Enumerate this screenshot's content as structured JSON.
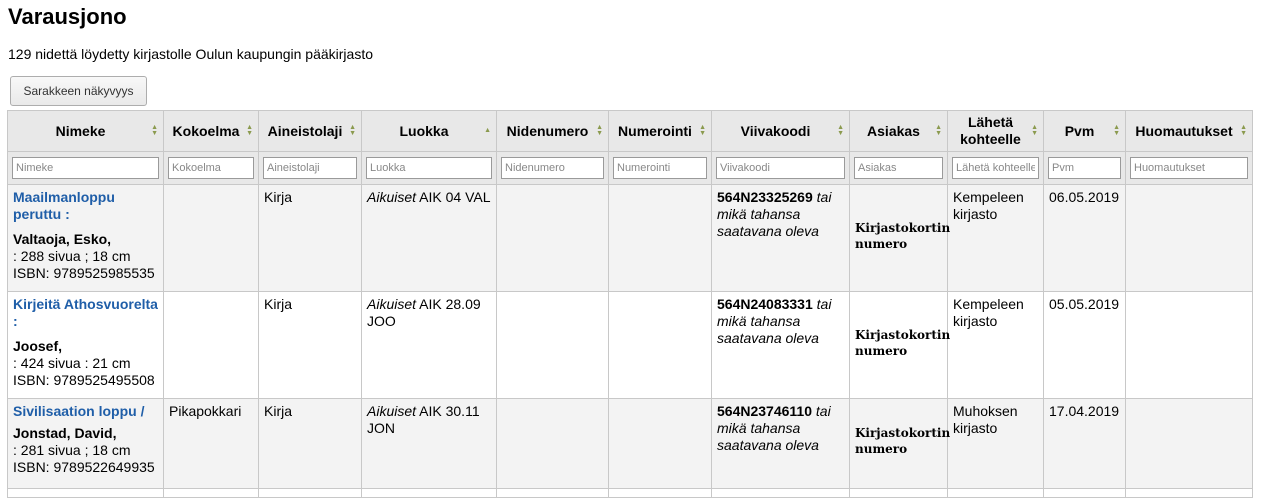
{
  "page": {
    "title": "Varausjono",
    "summary": "129 nidettä löydetty kirjastolle Oulun kaupungin pääkirjasto",
    "column_visibility_label": "Sarakkeen näkyvyys"
  },
  "table": {
    "headers": [
      "Nimeke",
      "Kokoelma",
      "Aineistolaji",
      "Luokka",
      "Nidenumero",
      "Numerointi",
      "Viivakoodi",
      "Asiakas",
      "Lähetä kohteelle",
      "Pvm",
      "Huomautukset"
    ],
    "filters": [
      "Nimeke",
      "Kokoelma",
      "Aineistolaji",
      "Luokka",
      "Nidenumero",
      "Numerointi",
      "Viivakoodi",
      "Asiakas",
      "Lähetä kohteelle",
      "Pvm",
      "Huomautukset"
    ],
    "sorted_column": "Luokka",
    "sort_direction": "ascending",
    "rows": [
      {
        "title": "Maailmanloppu peruttu :",
        "author": "Valtaoja, Esko,",
        "description": ": 288 sivua ; 18 cm",
        "isbn": "ISBN: 9789525985535",
        "collection": "",
        "item_type": "Kirja",
        "callnumber_prefix": "Aikuiset",
        "callnumber": " AIK 04 VAL",
        "barcode": "564N23325269",
        "barcode_alt": " tai mikä tahansa saatavana oleva",
        "patron": "Kirjastokortin numero",
        "send_to": "Kempeleen kirjasto",
        "date": "06.05.2019",
        "notes": ""
      },
      {
        "title": "Kirjeitä Athosvuorelta :",
        "author": "Joosef,",
        "description": ": 424 sivua : 21 cm",
        "isbn": "ISBN: 9789525495508",
        "collection": "",
        "item_type": "Kirja",
        "callnumber_prefix": "Aikuiset",
        "callnumber": " AIK 28.09 JOO",
        "barcode": "564N24083331",
        "barcode_alt": " tai mikä tahansa saatavana oleva",
        "patron": "Kirjastokortin numero",
        "send_to": "Kempeleen kirjasto",
        "date": "05.05.2019",
        "notes": ""
      },
      {
        "title": "Sivilisaation loppu /",
        "author": "Jonstad, David,",
        "description": ": 281 sivua ; 18 cm",
        "isbn": "ISBN: 9789522649935",
        "collection": "Pikapokkari",
        "item_type": "Kirja",
        "callnumber_prefix": "Aikuiset",
        "callnumber": " AIK 30.11 JON",
        "barcode": "564N23746110",
        "barcode_alt": " tai mikä tahansa saatavana oleva",
        "patron": "Kirjastokortin numero",
        "send_to": "Muhoksen kirjasto",
        "date": "17.04.2019",
        "notes": ""
      }
    ]
  }
}
